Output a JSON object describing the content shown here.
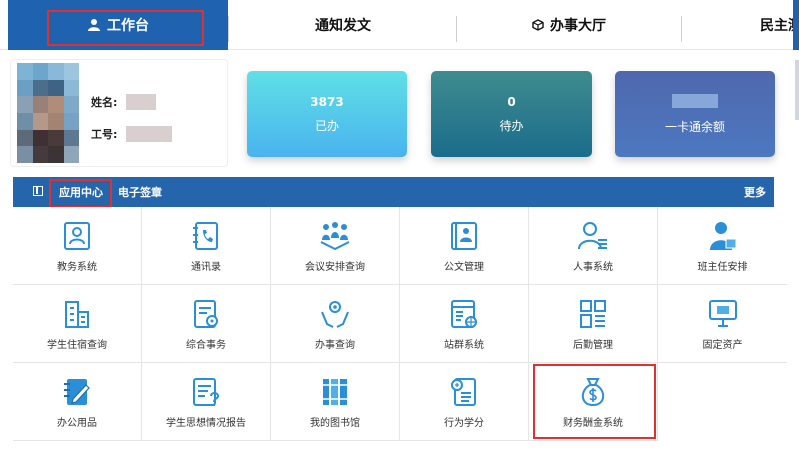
{
  "nav": {
    "tabs": [
      {
        "label": "工作台",
        "icon": "user-icon",
        "active": true
      },
      {
        "label": "通知发文"
      },
      {
        "label": "办事大厅",
        "icon": "cube-icon"
      },
      {
        "label": "民主测"
      }
    ]
  },
  "profile": {
    "name_label": "姓名:",
    "id_label": "工号:"
  },
  "stats": {
    "done": {
      "value": "3873",
      "label": "已办"
    },
    "todo": {
      "value": "0",
      "label": "待办"
    },
    "card": {
      "label": "一卡通余额"
    }
  },
  "app_center": {
    "tab_apps": "应用中心",
    "tab_esign": "电子签章",
    "more": "更多",
    "items": [
      {
        "label": "教务系统",
        "icon": "id-card-icon"
      },
      {
        "label": "通讯录",
        "icon": "phone-book-icon"
      },
      {
        "label": "会议安排查询",
        "icon": "meeting-icon"
      },
      {
        "label": "公文管理",
        "icon": "document-icon"
      },
      {
        "label": "人事系统",
        "icon": "person-list-icon"
      },
      {
        "label": "班主任安排",
        "icon": "teacher-icon"
      },
      {
        "label": "学生住宿查询",
        "icon": "building-icon"
      },
      {
        "label": "综合事务",
        "icon": "settings-doc-icon"
      },
      {
        "label": "办事查询",
        "icon": "hands-gear-icon"
      },
      {
        "label": "站群系统",
        "icon": "site-group-icon"
      },
      {
        "label": "后勤管理",
        "icon": "grid-apps-icon"
      },
      {
        "label": "固定资产",
        "icon": "monitor-icon"
      },
      {
        "label": "办公用品",
        "icon": "notebook-pen-icon"
      },
      {
        "label": "学生思想情况报告",
        "icon": "report-question-icon"
      },
      {
        "label": "我的图书馆",
        "icon": "books-icon"
      },
      {
        "label": "行为学分",
        "icon": "score-doc-icon"
      },
      {
        "label": "财务酬金系统",
        "icon": "money-bag-icon"
      }
    ]
  },
  "colors": {
    "brand_blue": "#2565ac",
    "icon_blue": "#2a8fd6",
    "highlight_red": "#e03131"
  }
}
